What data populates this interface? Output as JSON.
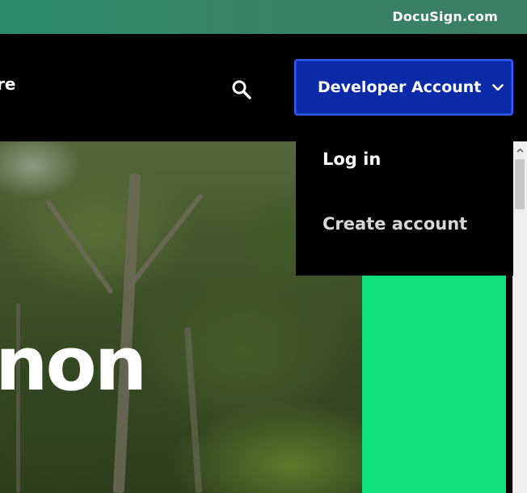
{
  "topbar": {
    "link_label": "DocuSign.com",
    "background": "#2f8466"
  },
  "nav": {
    "partial_label": "re",
    "search_icon": "search-icon",
    "developer_button": {
      "label": "Developer Account",
      "icon": "chevron-down-icon",
      "color": "#0a2aa8"
    }
  },
  "dropdown": {
    "items": [
      {
        "label": "Log in"
      },
      {
        "label": "Create account"
      }
    ]
  },
  "hero": {
    "headline_partial": "non",
    "accent_color": "#12e07e"
  }
}
